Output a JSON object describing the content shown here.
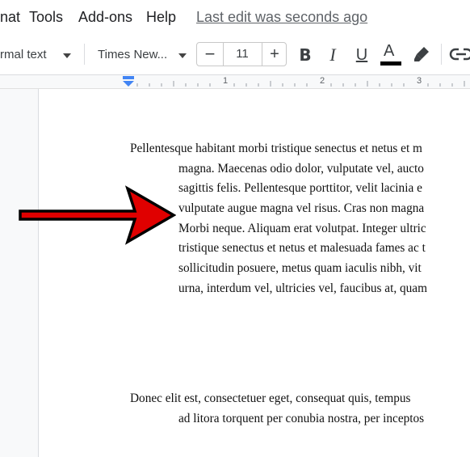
{
  "menu": {
    "format_partial": "nat",
    "tools": "Tools",
    "addons": "Add-ons",
    "help": "Help",
    "last_edit": "Last edit was seconds ago"
  },
  "toolbar": {
    "style": "rmal text",
    "font": "Times New...",
    "font_size": "11",
    "minus": "−",
    "plus": "+",
    "bold": "B",
    "italic": "I",
    "underline": "U",
    "text_color_letter": "A"
  },
  "ruler": {
    "marks": [
      "1",
      "2",
      "3"
    ]
  },
  "document": {
    "paragraph1": [
      "Pellentesque habitant morbi tristique senectus et netus et m",
      "magna. Maecenas odio dolor, vulputate vel, aucto",
      "sagittis felis. Pellentesque porttitor, velit lacinia e",
      "vulputate augue magna vel risus. Cras non magna",
      "Morbi neque. Aliquam erat volutpat. Integer ultric",
      "tristique senectus et netus et malesuada fames ac t",
      "sollicitudin posuere, metus quam iaculis nibh, vit",
      "urna, interdum vel, ultricies vel, faucibus at, quam"
    ],
    "paragraph2": [
      "Donec elit est, consectetuer eget, consequat quis, tempus",
      "ad litora torquent per conubia nostra, per inceptos"
    ]
  },
  "colors": {
    "arrow": "#e00000",
    "text_color_bar": "#000000",
    "indent_marker": "#4285f4"
  },
  "icons": {
    "pointer": "red-arrow-icon",
    "highlight": "highlighter-icon",
    "link": "link-icon"
  }
}
